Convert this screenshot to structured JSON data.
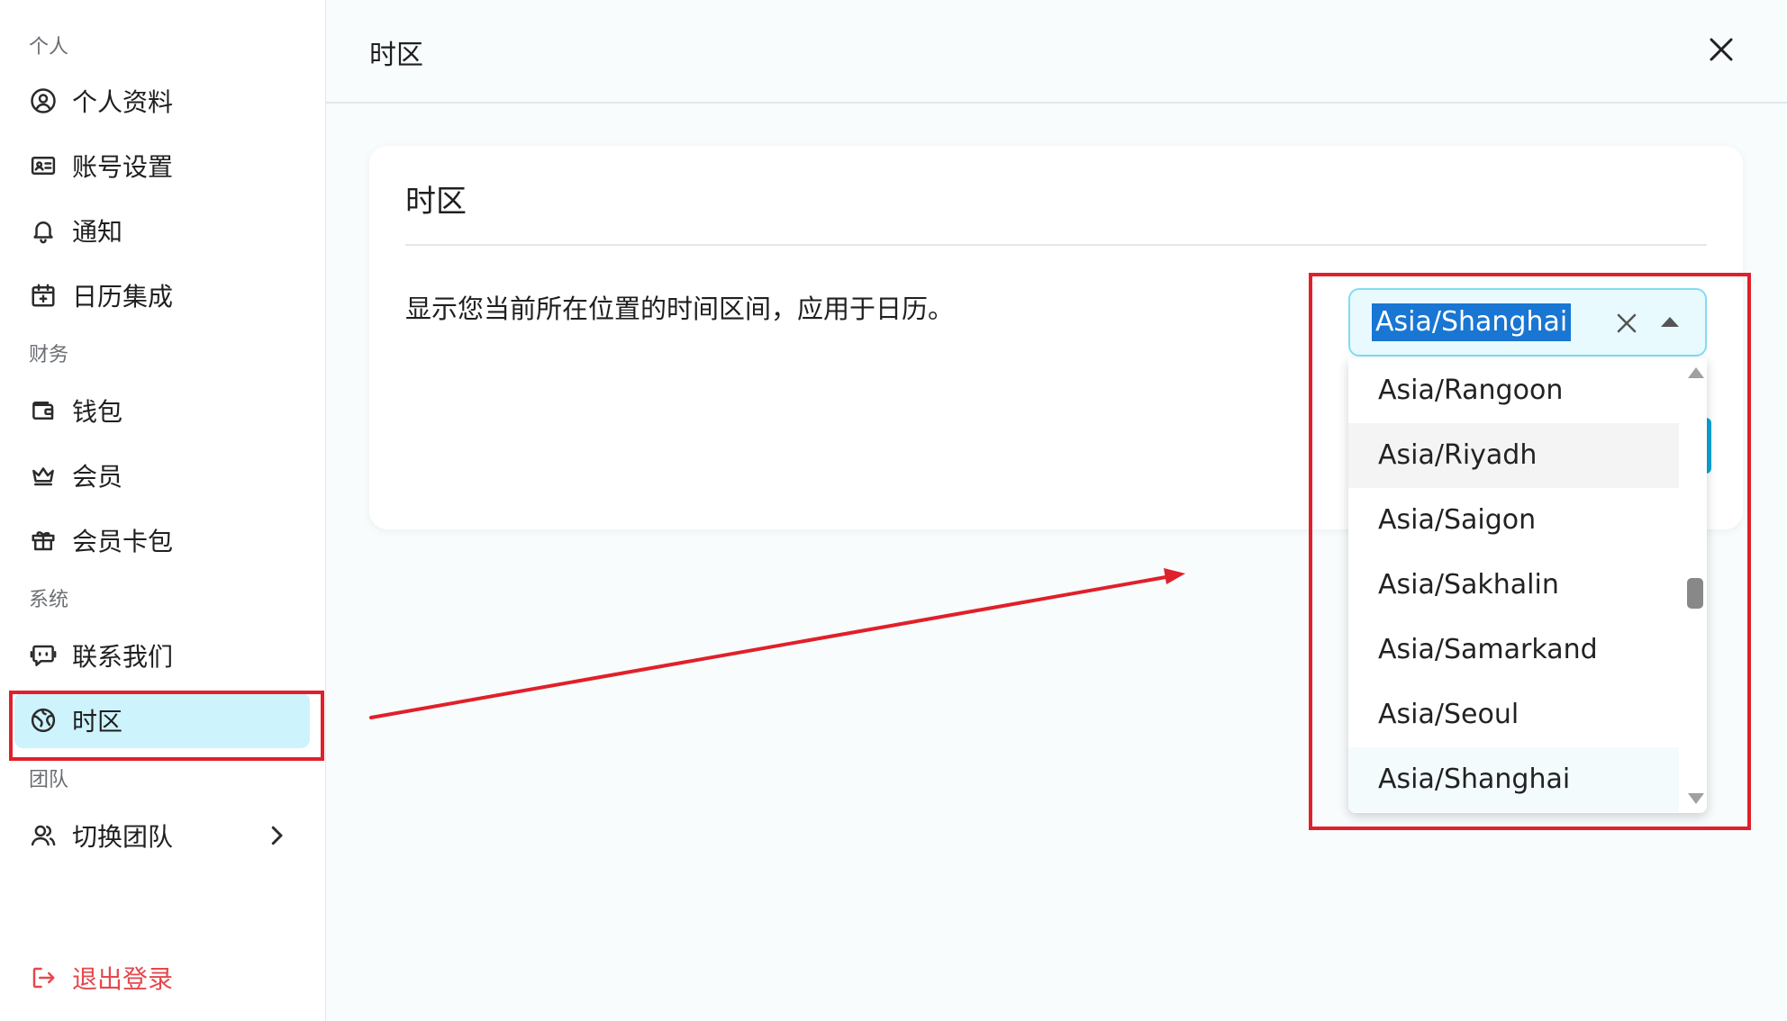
{
  "sidebar": {
    "sections": {
      "personal": "个人",
      "finance": "财务",
      "system": "系统",
      "team": "团队"
    },
    "items": {
      "profile": "个人资料",
      "account": "账号设置",
      "notifications": "通知",
      "calendar": "日历集成",
      "wallet": "钱包",
      "membership": "会员",
      "cards": "会员卡包",
      "contact": "联系我们",
      "timezone": "时区",
      "switch_team": "切换团队",
      "logout": "退出登录"
    },
    "active_item": "timezone"
  },
  "header": {
    "title": "时区"
  },
  "card": {
    "title": "时区",
    "description": "显示您当前所在位置的时间区间，应用于日历。"
  },
  "timezone_select": {
    "value": "Asia/Shanghai",
    "options": [
      "Asia/Rangoon",
      "Asia/Riyadh",
      "Asia/Saigon",
      "Asia/Sakhalin",
      "Asia/Samarkand",
      "Asia/Seoul",
      "Asia/Shanghai"
    ],
    "hovered": "Asia/Riyadh",
    "selected": "Asia/Shanghai"
  },
  "colors": {
    "active_bg": "#cdf3fc",
    "accent": "#0aa5d6",
    "logout": "#e5484d",
    "annotation": "#e0202a"
  },
  "icons": [
    "user-circle-icon",
    "id-card-icon",
    "bell-icon",
    "calendar-plus-icon",
    "wallet-icon",
    "crown-icon",
    "gift-icon",
    "chat-bot-icon",
    "globe-icon",
    "users-icon",
    "chevron-right-icon",
    "logout-icon",
    "close-icon",
    "clear-icon",
    "caret-up-icon"
  ]
}
